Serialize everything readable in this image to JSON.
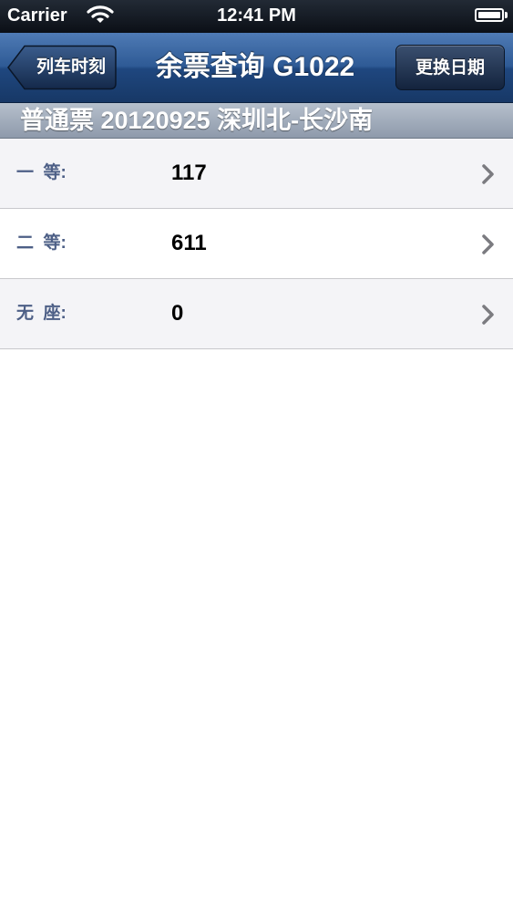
{
  "status_bar": {
    "carrier": "Carrier",
    "time": "12:41 PM"
  },
  "nav": {
    "back_label": "列车时刻",
    "title": "余票查询 G1022",
    "right_label": "更换日期"
  },
  "section_header": "普通票 20120925 深圳北-长沙南",
  "seats": [
    {
      "label": "一  等:",
      "count": "117"
    },
    {
      "label": "二  等:",
      "count": "611"
    },
    {
      "label": "无  座:",
      "count": "0"
    }
  ],
  "colors": {
    "nav_bar": "#2e5a95",
    "label_text": "#4d5f86",
    "section_header": "#9ea9b8"
  }
}
